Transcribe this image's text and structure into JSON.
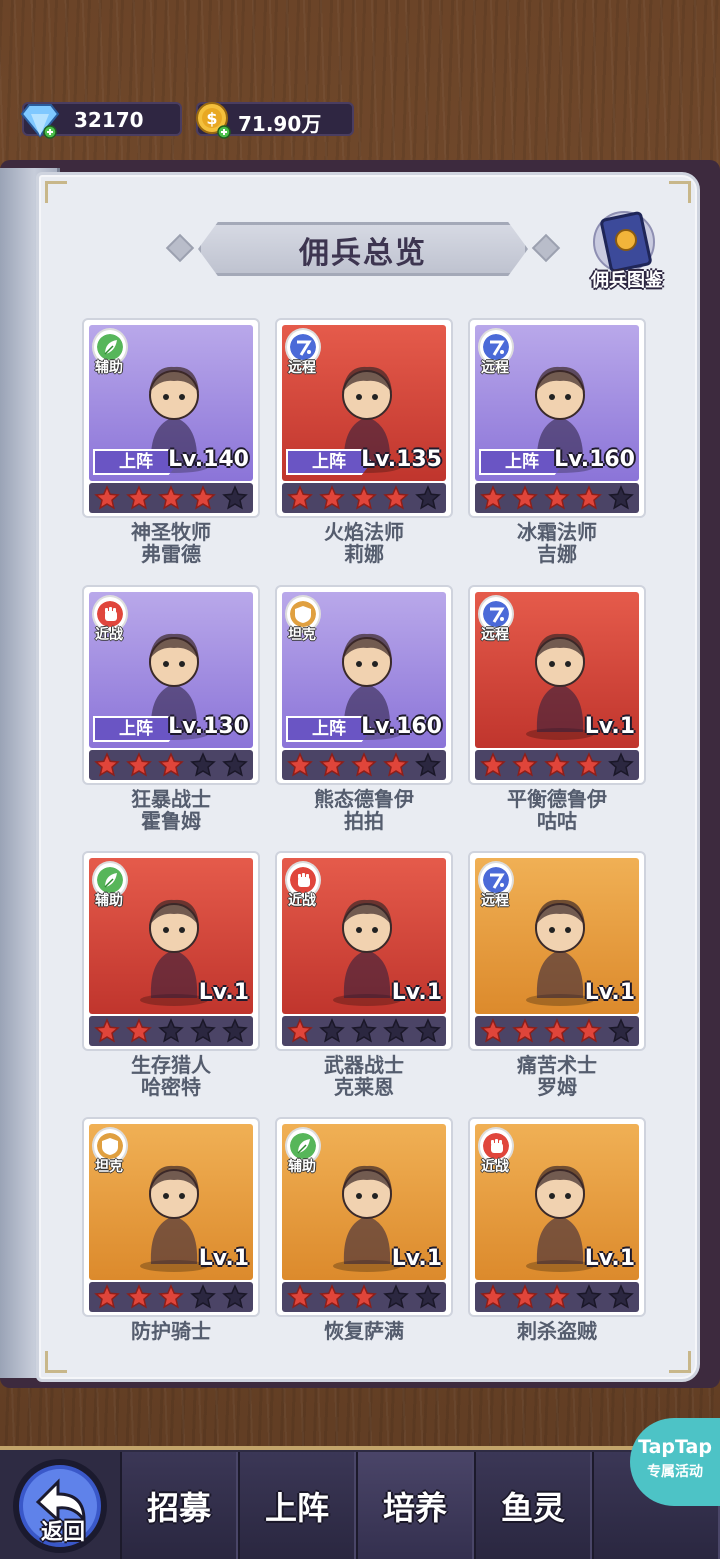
{
  "currency": {
    "gems": {
      "value": "32170",
      "icon": "diamond-plus-icon"
    },
    "gold": {
      "value": "71.90万",
      "icon": "gold-coin-plus-icon"
    }
  },
  "page": {
    "title": "佣兵总览",
    "codex_label": "佣兵图鉴"
  },
  "cards": [
    {
      "role": "辅助",
      "name1": "神圣牧师",
      "name2": "弗雷德",
      "level": "Lv.140",
      "deployed": true,
      "stars": 4,
      "bg": "purple"
    },
    {
      "role": "远程",
      "name1": "火焰法师",
      "name2": "莉娜",
      "level": "Lv.135",
      "deployed": true,
      "stars": 4,
      "bg": "red"
    },
    {
      "role": "远程",
      "name1": "冰霜法师",
      "name2": "吉娜",
      "level": "Lv.160",
      "deployed": true,
      "stars": 4,
      "bg": "purple"
    },
    {
      "role": "近战",
      "name1": "狂暴战士",
      "name2": "霍鲁姆",
      "level": "Lv.130",
      "deployed": true,
      "stars": 3,
      "bg": "purple"
    },
    {
      "role": "坦克",
      "name1": "熊态德鲁伊",
      "name2": "拍拍",
      "level": "Lv.160",
      "deployed": true,
      "stars": 4,
      "bg": "purple"
    },
    {
      "role": "远程",
      "name1": "平衡德鲁伊",
      "name2": "咕咕",
      "level": "Lv.1",
      "deployed": false,
      "stars": 4,
      "bg": "red"
    },
    {
      "role": "辅助",
      "name1": "生存猎人",
      "name2": "哈密特",
      "level": "Lv.1",
      "deployed": false,
      "stars": 2,
      "bg": "red"
    },
    {
      "role": "近战",
      "name1": "武器战士",
      "name2": "克莱恩",
      "level": "Lv.1",
      "deployed": false,
      "stars": 1,
      "bg": "red"
    },
    {
      "role": "远程",
      "name1": "痛苦术士",
      "name2": "罗姆",
      "level": "Lv.1",
      "deployed": false,
      "stars": 4,
      "bg": "orange"
    },
    {
      "role": "坦克",
      "name1": "防护骑士",
      "name2": "",
      "level": "Lv.1",
      "deployed": false,
      "stars": 3,
      "bg": "orange"
    },
    {
      "role": "辅助",
      "name1": "恢复萨满",
      "name2": "",
      "level": "Lv.1",
      "deployed": false,
      "stars": 3,
      "bg": "orange"
    },
    {
      "role": "近战",
      "name1": "刺杀盗贼",
      "name2": "",
      "level": "Lv.1",
      "deployed": false,
      "stars": 3,
      "bg": "orange"
    }
  ],
  "deploy_label": "上阵",
  "role_colors": {
    "辅助": "#57b65a",
    "远程": "#4b6ad8",
    "近战": "#e0463c",
    "坦克": "#e0a040"
  },
  "nav": {
    "back_label": "返回",
    "tabs": [
      "招募",
      "上阵",
      "培养",
      "鱼灵"
    ],
    "active_tab": "培养"
  },
  "taptap": {
    "line1": "TapTap",
    "line2": "专属活动"
  }
}
